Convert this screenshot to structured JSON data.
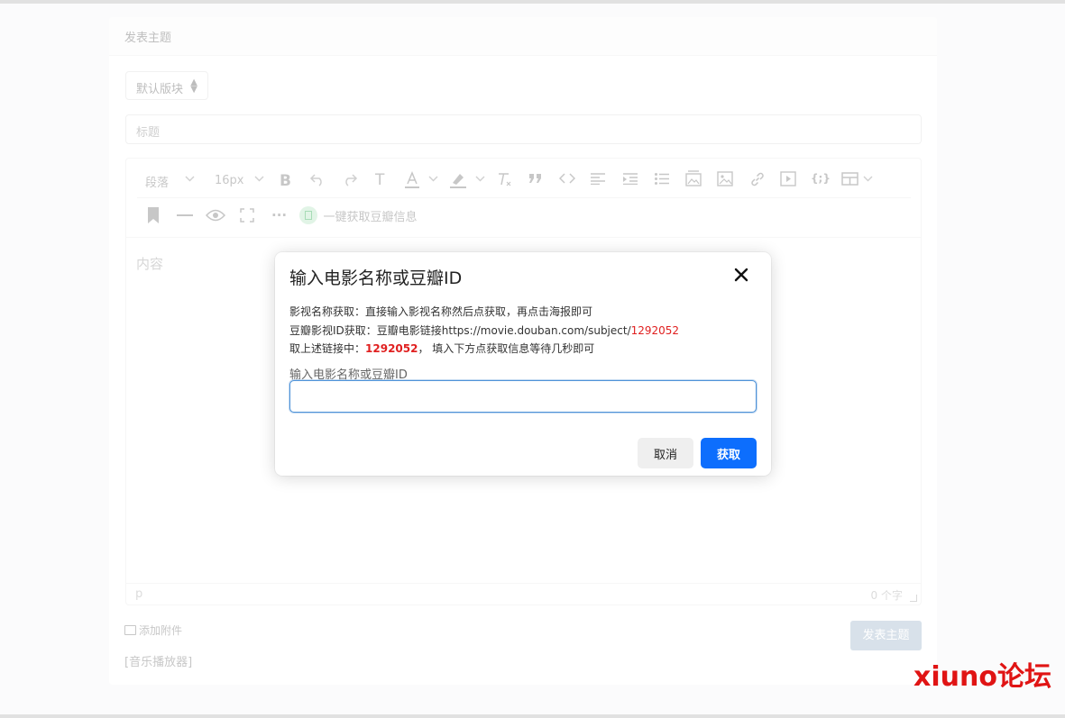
{
  "page": {
    "header_title": "发表主题",
    "board_select": "默认版块",
    "title_placeholder": "标题",
    "content_placeholder": "内容",
    "status_path": "p",
    "word_count": "0 个字",
    "attach_label": "添加附件",
    "music_label": "[音乐播放器]",
    "post_button": "发表主题"
  },
  "toolbar": {
    "paragraph": "段落",
    "font_size": "16px",
    "text_t": "T",
    "douban_button": "一键获取豆瓣信息",
    "more": "···"
  },
  "modal": {
    "title": "输入电影名称或豆瓣ID",
    "line1": "影视名称获取：直接输入影视名称然后点获取，再点击海报即可",
    "line2_prefix": "豆瓣影视ID获取：豆瓣电影链接https://movie.douban.com/subject/",
    "line2_id": "1292052",
    "line3_prefix": "取上述链接中：",
    "line3_id": "1292052",
    "line3_suffix": "， 填入下方点获取信息等待几秒即可",
    "input_label": "输入电影名称或豆瓣ID",
    "input_value": "",
    "cancel_button": "取消",
    "fetch_button": "获取"
  },
  "watermark": "xiuno论坛",
  "colors": {
    "primary": "#0d6efd",
    "highlight_red": "#e02020",
    "watermark_red": "#e01414"
  }
}
